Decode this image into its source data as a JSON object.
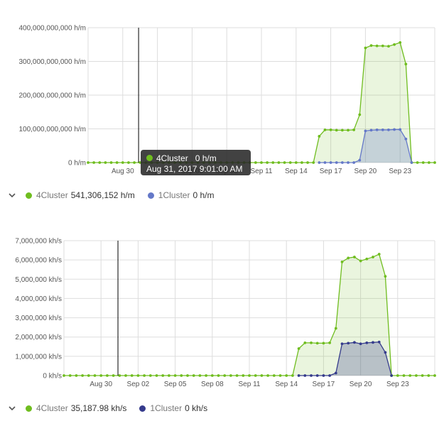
{
  "colors": {
    "series_4cluster": "#6fbd1f",
    "series_1cluster_top": "#6478c8",
    "series_1cluster_bottom": "#353b8c",
    "grid": "#dddddd",
    "tooltip_bg": "#2a2a2a"
  },
  "icons": {
    "legend_toggle": "chevron-down-icon",
    "legend_dot": "circle"
  },
  "tooltip": {
    "series_label": "4Cluster",
    "value": "0 h/m",
    "timestamp": "Aug 31, 2017 9:01:00 AM"
  },
  "legend_top": [
    {
      "name": "4Cluster",
      "value": "541,306,152 h/m"
    },
    {
      "name": "1Cluster",
      "value": "0 h/m"
    }
  ],
  "legend_bottom": [
    {
      "name": "4Cluster",
      "value": "35,187.98 kh/s"
    },
    {
      "name": "1Cluster",
      "value": "0 kh/s"
    }
  ],
  "chart_data": [
    {
      "type": "area",
      "unit": "h/m",
      "ylim": [
        0,
        400000000000
      ],
      "ytick_values": [
        0,
        100000000000,
        200000000000,
        300000000000,
        400000000000
      ],
      "ytick_labels": [
        "0 h/m",
        "100,000,000,000 h/m",
        "200,000,000,000 h/m",
        "300,000,000,000 h/m",
        "400,000,000,000 h/m"
      ],
      "x_start": "Aug 27",
      "x_end": "Sep 26",
      "xtick_labels": [
        "Aug 30",
        "Sep 02",
        "Sep 05",
        "Sep 08",
        "Sep 11",
        "Sep 14",
        "Sep 17",
        "Sep 20",
        "Sep 23"
      ],
      "xtick_days": [
        3,
        6,
        9,
        12,
        15,
        18,
        21,
        24,
        27
      ],
      "crosshair_day": 4.37,
      "grid": true,
      "series": [
        {
          "name": "4Cluster",
          "points": [
            [
              0,
              0
            ],
            [
              0.5,
              0
            ],
            [
              1,
              0
            ],
            [
              1.5,
              0
            ],
            [
              2,
              0
            ],
            [
              2.5,
              0
            ],
            [
              3,
              0
            ],
            [
              3.5,
              0
            ],
            [
              4,
              0
            ],
            [
              4.5,
              0
            ],
            [
              5,
              0
            ],
            [
              5.5,
              0
            ],
            [
              6,
              0
            ],
            [
              6.5,
              0
            ],
            [
              7,
              0
            ],
            [
              7.5,
              0
            ],
            [
              8,
              0
            ],
            [
              8.5,
              0
            ],
            [
              9,
              0
            ],
            [
              9.5,
              0
            ],
            [
              10,
              0
            ],
            [
              10.5,
              0
            ],
            [
              11,
              0
            ],
            [
              11.5,
              0
            ],
            [
              12,
              0
            ],
            [
              12.5,
              0
            ],
            [
              13,
              0
            ],
            [
              13.5,
              0
            ],
            [
              14,
              0
            ],
            [
              14.5,
              0
            ],
            [
              15,
              0
            ],
            [
              15.5,
              0
            ],
            [
              16,
              0
            ],
            [
              16.5,
              0
            ],
            [
              17,
              0
            ],
            [
              17.5,
              0
            ],
            [
              18,
              0
            ],
            [
              18.5,
              0
            ],
            [
              19,
              0
            ],
            [
              19.5,
              0
            ],
            [
              20,
              78000000000
            ],
            [
              20.5,
              97000000000
            ],
            [
              21,
              97000000000
            ],
            [
              21.5,
              96000000000
            ],
            [
              22,
              96000000000
            ],
            [
              22.5,
              96000000000
            ],
            [
              23,
              97000000000
            ],
            [
              23.5,
              142000000000
            ],
            [
              24,
              340000000000
            ],
            [
              24.5,
              347000000000
            ],
            [
              25,
              346000000000
            ],
            [
              25.5,
              346000000000
            ],
            [
              26,
              345000000000
            ],
            [
              26.5,
              350000000000
            ],
            [
              27,
              356000000000
            ],
            [
              27.5,
              292000000000
            ],
            [
              28,
              0
            ],
            [
              28.5,
              0
            ],
            [
              29,
              0
            ],
            [
              29.5,
              0
            ],
            [
              30,
              0
            ]
          ]
        },
        {
          "name": "1Cluster",
          "points": [
            [
              20,
              0
            ],
            [
              20.5,
              0
            ],
            [
              21,
              0
            ],
            [
              21.5,
              0
            ],
            [
              22,
              0
            ],
            [
              22.5,
              0
            ],
            [
              23,
              0
            ],
            [
              23.5,
              7000000000
            ],
            [
              24,
              94000000000
            ],
            [
              24.5,
              96000000000
            ],
            [
              25,
              97000000000
            ],
            [
              25.5,
              97000000000
            ],
            [
              26,
              97000000000
            ],
            [
              26.5,
              98000000000
            ],
            [
              27,
              98000000000
            ],
            [
              27.5,
              70000000000
            ],
            [
              28,
              0
            ]
          ]
        }
      ]
    },
    {
      "type": "area",
      "unit": "kh/s",
      "ylim": [
        0,
        7000000
      ],
      "ytick_values": [
        0,
        1000000,
        2000000,
        3000000,
        4000000,
        5000000,
        6000000,
        7000000
      ],
      "ytick_labels": [
        "0 kh/s",
        "1,000,000 kh/s",
        "2,000,000 kh/s",
        "3,000,000 kh/s",
        "4,000,000 kh/s",
        "5,000,000 kh/s",
        "6,000,000 kh/s",
        "7,000,000 kh/s"
      ],
      "x_start": "Aug 27",
      "x_end": "Sep 26",
      "xtick_labels": [
        "Aug 30",
        "Sep 02",
        "Sep 05",
        "Sep 08",
        "Sep 11",
        "Sep 14",
        "Sep 17",
        "Sep 20",
        "Sep 23"
      ],
      "xtick_days": [
        3,
        6,
        9,
        12,
        15,
        18,
        21,
        24,
        27
      ],
      "crosshair_day": 4.37,
      "grid": true,
      "series": [
        {
          "name": "4Cluster",
          "points": [
            [
              0,
              0
            ],
            [
              0.5,
              0
            ],
            [
              1,
              0
            ],
            [
              1.5,
              0
            ],
            [
              2,
              0
            ],
            [
              2.5,
              0
            ],
            [
              3,
              0
            ],
            [
              3.5,
              0
            ],
            [
              4,
              0
            ],
            [
              4.5,
              0
            ],
            [
              5,
              0
            ],
            [
              5.5,
              0
            ],
            [
              6,
              0
            ],
            [
              6.5,
              0
            ],
            [
              7,
              0
            ],
            [
              7.5,
              0
            ],
            [
              8,
              0
            ],
            [
              8.5,
              0
            ],
            [
              9,
              0
            ],
            [
              9.5,
              0
            ],
            [
              10,
              0
            ],
            [
              10.5,
              0
            ],
            [
              11,
              0
            ],
            [
              11.5,
              0
            ],
            [
              12,
              0
            ],
            [
              12.5,
              0
            ],
            [
              13,
              0
            ],
            [
              13.5,
              0
            ],
            [
              14,
              0
            ],
            [
              14.5,
              0
            ],
            [
              15,
              0
            ],
            [
              15.5,
              0
            ],
            [
              16,
              0
            ],
            [
              16.5,
              0
            ],
            [
              17,
              0
            ],
            [
              17.5,
              0
            ],
            [
              18,
              0
            ],
            [
              18.5,
              0
            ],
            [
              19,
              1400000
            ],
            [
              19.5,
              1700000
            ],
            [
              20,
              1700000
            ],
            [
              20.5,
              1680000
            ],
            [
              21,
              1680000
            ],
            [
              21.5,
              1700000
            ],
            [
              22,
              2450000
            ],
            [
              22.5,
              5900000
            ],
            [
              23,
              6100000
            ],
            [
              23.5,
              6150000
            ],
            [
              24,
              5950000
            ],
            [
              24.5,
              6050000
            ],
            [
              25,
              6150000
            ],
            [
              25.5,
              6300000
            ],
            [
              26,
              5150000
            ],
            [
              26.5,
              0
            ],
            [
              27,
              0
            ],
            [
              27.5,
              0
            ],
            [
              28,
              0
            ],
            [
              28.5,
              0
            ],
            [
              29,
              0
            ],
            [
              29.5,
              0
            ],
            [
              30,
              0
            ]
          ]
        },
        {
          "name": "1Cluster",
          "points": [
            [
              19,
              0
            ],
            [
              19.5,
              0
            ],
            [
              20,
              0
            ],
            [
              20.5,
              0
            ],
            [
              21,
              0
            ],
            [
              21.5,
              0
            ],
            [
              22,
              130000
            ],
            [
              22.5,
              1650000
            ],
            [
              23,
              1680000
            ],
            [
              23.5,
              1720000
            ],
            [
              24,
              1650000
            ],
            [
              24.5,
              1700000
            ],
            [
              25,
              1720000
            ],
            [
              25.5,
              1740000
            ],
            [
              26,
              1200000
            ],
            [
              26.5,
              0
            ]
          ]
        }
      ]
    }
  ]
}
